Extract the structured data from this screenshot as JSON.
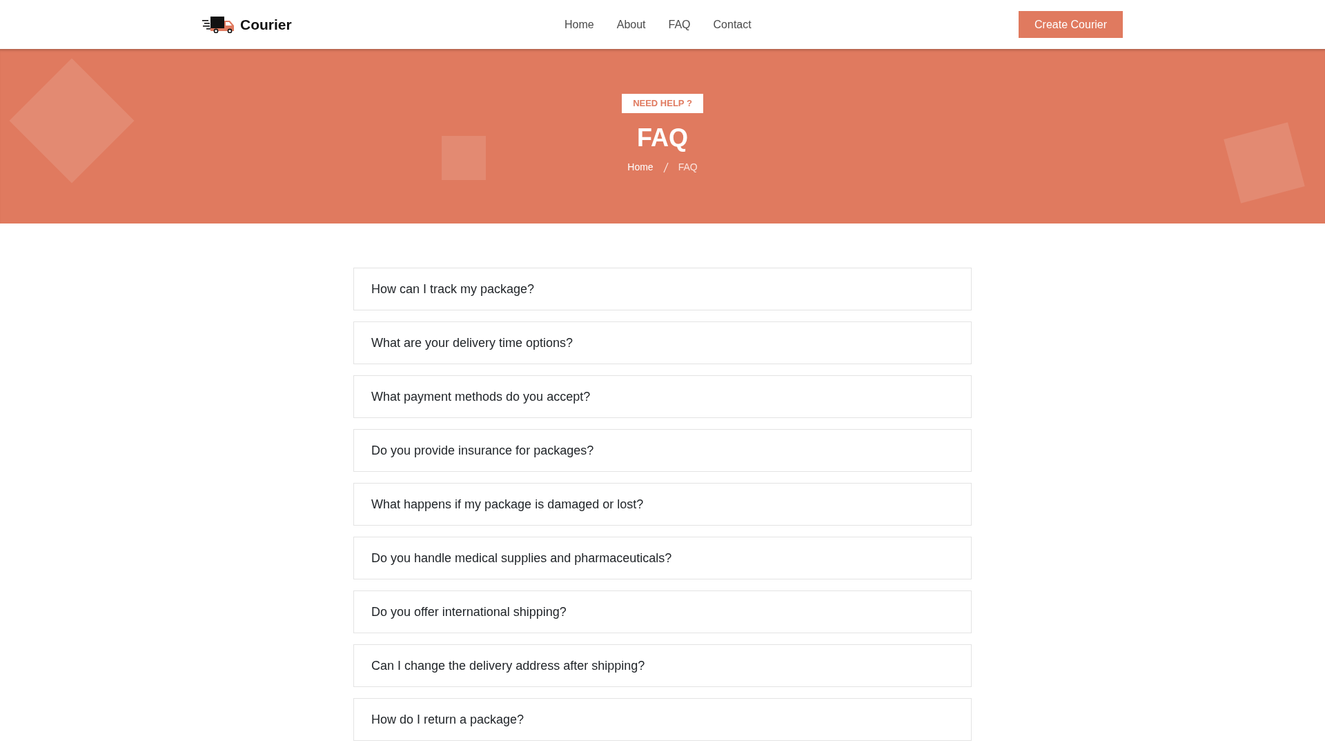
{
  "navbar": {
    "brand": "Courier",
    "links": [
      "Home",
      "About",
      "FAQ",
      "Contact"
    ],
    "cta": "Create Courier"
  },
  "hero": {
    "badge": "NEED HELP ?",
    "title": "FAQ",
    "breadcrumb": [
      {
        "label": "Home",
        "current": false
      },
      {
        "label": "FAQ",
        "current": true
      }
    ]
  },
  "faq": [
    "How can I track my package?",
    "What are your delivery time options?",
    "What payment methods do you accept?",
    "Do you provide insurance for packages?",
    "What happens if my package is damaged or lost?",
    "Do you handle medical supplies and pharmaceuticals?",
    "Do you offer international shipping?",
    "Can I change the delivery address after shipping?",
    "How do I return a package?"
  ]
}
